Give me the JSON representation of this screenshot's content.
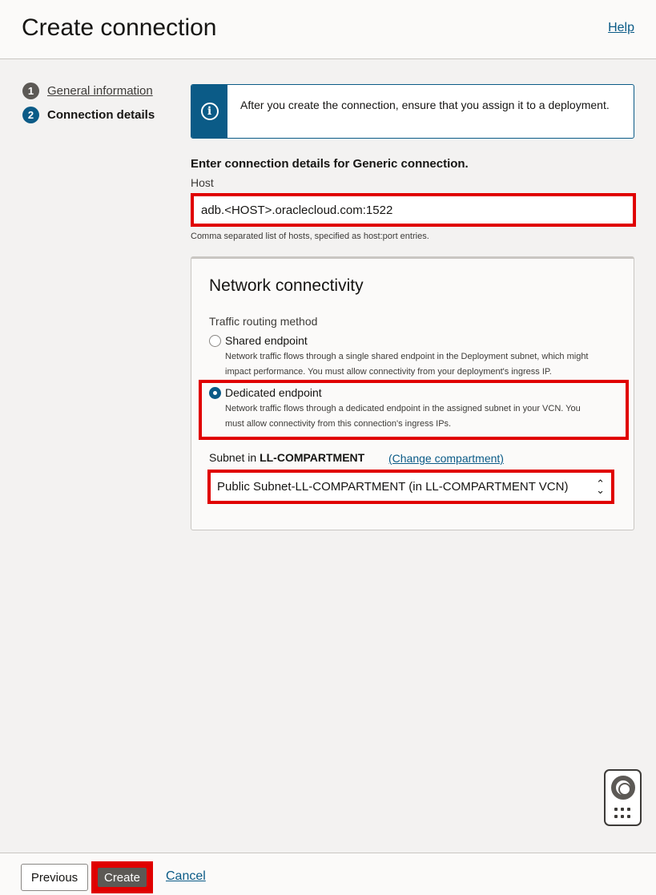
{
  "header": {
    "title": "Create connection",
    "help": "Help"
  },
  "steps": [
    {
      "num": "1",
      "label": "General information"
    },
    {
      "num": "2",
      "label": "Connection details"
    }
  ],
  "info": {
    "text": "After you create the connection, ensure that you assign it to a deployment.",
    "icon": "info-icon"
  },
  "form": {
    "section_title": "Enter connection details for Generic connection.",
    "host_label": "Host",
    "host_value": "adb.<HOST>.oraclecloud.com:1522",
    "host_hint": "Comma separated list of hosts, specified as host:port entries."
  },
  "network": {
    "title": "Network connectivity",
    "routing_label": "Traffic routing method",
    "options": [
      {
        "label": "Shared endpoint",
        "selected": false,
        "desc_lines": [
          "Network traffic flows through a single shared endpoint in the Deployment subnet, which might",
          "impact performance. You must allow connectivity from your deployment's ingress IP."
        ]
      },
      {
        "label": "Dedicated endpoint",
        "selected": true,
        "desc_lines": [
          "Network traffic flows through a dedicated endpoint in the assigned subnet in your VCN. You",
          "must allow connectivity from this connection's ingress IPs."
        ]
      }
    ],
    "subnet_prefix": "Subnet in",
    "subnet_compartment": "LL-COMPARTMENT",
    "change_compartment": "(Change compartment)",
    "subnet_selected": "Public Subnet-LL-COMPARTMENT (in LL-COMPARTMENT VCN)"
  },
  "footer": {
    "previous": "Previous",
    "create": "Create",
    "cancel": "Cancel"
  },
  "colors": {
    "accent": "#0b5b87",
    "highlight": "#e00000"
  }
}
